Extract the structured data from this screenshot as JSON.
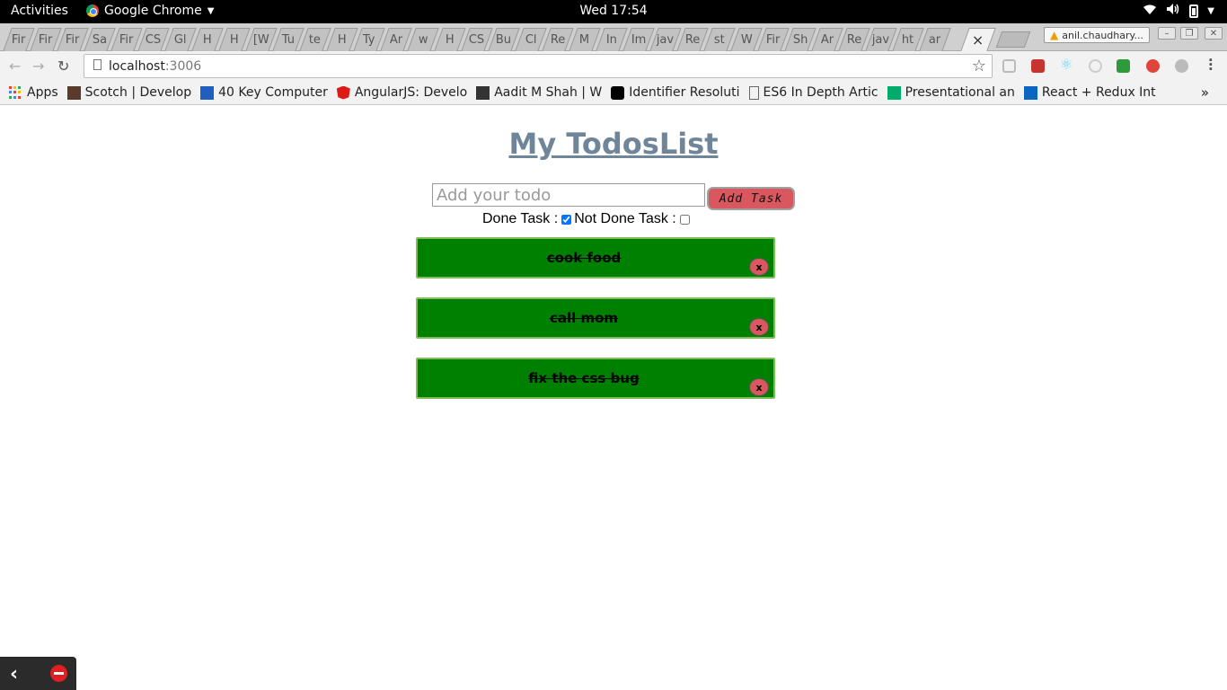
{
  "topbar": {
    "activities": "Activities",
    "app_name": "Google Chrome",
    "clock": "Wed 17:54"
  },
  "tabs": [
    "Fir",
    "Fir",
    "Fir",
    "Sa",
    "Fir",
    "CS",
    "Gl",
    "H",
    "H",
    "[W",
    "Tu",
    "te",
    "H",
    "Ty",
    "Ar",
    "w",
    "H",
    "CS",
    "Bu",
    "Cl",
    "Re",
    "M",
    "In",
    "Im",
    "jav",
    "Re",
    "st",
    "W",
    "Fir",
    "Sh",
    "Ar",
    "Re",
    "jav",
    "ht",
    "ar"
  ],
  "active_tab_close": "×",
  "profile": "anil.chaudhary...",
  "address_bar": {
    "host": "localhost",
    "port": ":3006"
  },
  "bookmarks": [
    {
      "label": "Apps",
      "icon": "apps-grid-icon"
    },
    {
      "label": "Scotch | Develop",
      "icon": "scotch-icon"
    },
    {
      "label": "40 Key Computer",
      "icon": "c-letter-icon"
    },
    {
      "label": "AngularJS: Develo",
      "icon": "angular-icon"
    },
    {
      "label": "Aadit M Shah | W",
      "icon": "avatar-icon"
    },
    {
      "label": "Identifier Resoluti",
      "icon": "circle-o-icon"
    },
    {
      "label": "ES6 In Depth Artic",
      "icon": "page-icon"
    },
    {
      "label": "Presentational an",
      "icon": "medium-icon"
    },
    {
      "label": "React + Redux Int",
      "icon": "linkedin-icon"
    }
  ],
  "bookmarks_more": "»",
  "app": {
    "title": "My TodosList",
    "input_placeholder": "Add your todo",
    "add_button": "Add Task",
    "done_label": "Done Task :",
    "not_done_label": "Not Done Task :",
    "done_checked": true,
    "not_done_checked": false,
    "todos": [
      {
        "text": "cook food",
        "done": true
      },
      {
        "text": "call mom",
        "done": true
      },
      {
        "text": "fix the css bug",
        "done": true
      }
    ],
    "delete_label": "x"
  },
  "colors": {
    "todo_bg": "#008000",
    "button_red": "#d9575e",
    "title_color": "#6f8599"
  }
}
